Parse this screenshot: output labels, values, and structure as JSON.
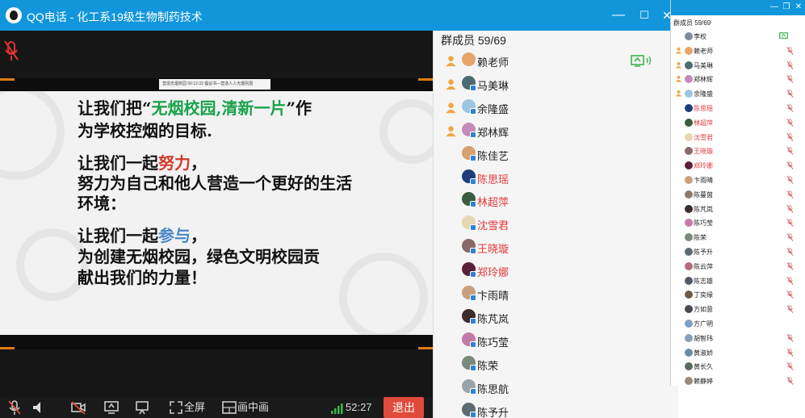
{
  "window": {
    "title": "QQ电话 - 化工系19级生物制药技术",
    "minimize": "—",
    "maximize": "☐",
    "close": "✕"
  },
  "slide": {
    "mini_caption": "营造无烟校园   00:12:32   倡议书—营造人人无烟氛围",
    "line1_a": "让我们把“",
    "line1_hl": "无烟校园,清新一片",
    "line1_b": "”作",
    "line2": "为学校控烟的目标.",
    "line3_a": "让我们一起",
    "line3_hl": "努力",
    "line3_b": "，",
    "line4": "努力为自己和他人营造一个更好的生活",
    "line5": "环境：",
    "line6_a": "让我们一起",
    "line6_hl": "参与",
    "line6_b": "，",
    "line7": "为创建无烟校园，绿色文明校园贡",
    "line8": "献出我们的力量！"
  },
  "toolbar": {
    "fullscreen_label": "全屏",
    "pip_label": "画中画",
    "timer": "52:27",
    "exit_label": "退出"
  },
  "members": {
    "header": "群成员 59/69",
    "rows": [
      {
        "name": "赖老师",
        "admin": true,
        "red": false,
        "avatar": "#e7a56b",
        "sharing": true
      },
      {
        "name": "马美琳",
        "admin": true,
        "red": false,
        "avatar": "#4d6b6e",
        "sharing": false
      },
      {
        "name": "余隆盛",
        "admin": true,
        "red": false,
        "avatar": "#9cc6e0",
        "sharing": false
      },
      {
        "name": "郑林辉",
        "admin": true,
        "red": false,
        "avatar": "#c58ab8",
        "sharing": false
      },
      {
        "name": "陈佳艺",
        "admin": false,
        "red": false,
        "avatar": "#d6a070",
        "sharing": false
      },
      {
        "name": "陈思瑶",
        "admin": false,
        "red": true,
        "avatar": "#1e3d7a",
        "sharing": false
      },
      {
        "name": "林超萍",
        "admin": false,
        "red": true,
        "avatar": "#3b5d3f",
        "sharing": false
      },
      {
        "name": "沈雪君",
        "admin": false,
        "red": true,
        "avatar": "#e6d6b2",
        "sharing": false
      },
      {
        "name": "王晓璇",
        "admin": false,
        "red": true,
        "avatar": "#8a6a66",
        "sharing": false
      },
      {
        "name": "郑玲娜",
        "admin": false,
        "red": true,
        "avatar": "#5a1f3a",
        "sharing": false
      },
      {
        "name": "卞雨晴",
        "admin": false,
        "red": false,
        "avatar": "#c9a07e",
        "sharing": false
      },
      {
        "name": "陈芃岚",
        "admin": false,
        "red": false,
        "avatar": "#3a2d2a",
        "sharing": false
      },
      {
        "name": "陈巧莹",
        "admin": false,
        "red": false,
        "avatar": "#c47aa5",
        "sharing": false
      },
      {
        "name": "陈荣",
        "admin": false,
        "red": false,
        "avatar": "#7b8a7a",
        "sharing": false
      },
      {
        "name": "陈思航",
        "admin": false,
        "red": false,
        "avatar": "#9aa4a8",
        "sharing": false
      },
      {
        "name": "陈予升",
        "admin": false,
        "red": false,
        "avatar": "#5d6b70",
        "sharing": false
      }
    ]
  },
  "small_window": {
    "minimize": "—",
    "restore": "❐",
    "close": "✕",
    "header": "群成员 59/69",
    "rows": [
      {
        "name": "李权",
        "admin": false,
        "red": false,
        "avatar": "#7e8b98",
        "share": true,
        "mute": false
      },
      {
        "name": "赖老师",
        "admin": true,
        "red": false,
        "avatar": "#e7a56b",
        "share": false,
        "mute": true
      },
      {
        "name": "马美琳",
        "admin": true,
        "red": false,
        "avatar": "#4d6b6e",
        "share": false,
        "mute": true
      },
      {
        "name": "郑林辉",
        "admin": true,
        "red": false,
        "avatar": "#c58ab8",
        "share": false,
        "mute": true
      },
      {
        "name": "余隆盛",
        "admin": true,
        "red": false,
        "avatar": "#9cc6e0",
        "share": false,
        "mute": true
      },
      {
        "name": "陈思瑶",
        "admin": false,
        "red": true,
        "avatar": "#1e3d7a",
        "share": false,
        "mute": true
      },
      {
        "name": "林超萍",
        "admin": false,
        "red": true,
        "avatar": "#3b5d3f",
        "share": false,
        "mute": true
      },
      {
        "name": "沈雪君",
        "admin": false,
        "red": true,
        "avatar": "#e6d6b2",
        "share": false,
        "mute": true
      },
      {
        "name": "王晓璇",
        "admin": false,
        "red": true,
        "avatar": "#8a6a66",
        "share": false,
        "mute": true
      },
      {
        "name": "郑玲娜",
        "admin": false,
        "red": true,
        "avatar": "#5a1f3a",
        "share": false,
        "mute": true
      },
      {
        "name": "卞雨晴",
        "admin": false,
        "red": false,
        "avatar": "#c9a07e",
        "share": false,
        "mute": true
      },
      {
        "name": "陈蔓茵",
        "admin": false,
        "red": false,
        "avatar": "#8c7c70",
        "share": false,
        "mute": true
      },
      {
        "name": "陈芃岚",
        "admin": false,
        "red": false,
        "avatar": "#3a2d2a",
        "share": false,
        "mute": true
      },
      {
        "name": "陈巧莹",
        "admin": false,
        "red": false,
        "avatar": "#c47aa5",
        "share": false,
        "mute": true
      },
      {
        "name": "陈荣",
        "admin": false,
        "red": false,
        "avatar": "#7b8a7a",
        "share": false,
        "mute": true
      },
      {
        "name": "陈予升",
        "admin": false,
        "red": false,
        "avatar": "#5d6b70",
        "share": false,
        "mute": true
      },
      {
        "name": "陈云萍",
        "admin": false,
        "red": false,
        "avatar": "#b66b7a",
        "share": false,
        "mute": true
      },
      {
        "name": "陈志雄",
        "admin": false,
        "red": false,
        "avatar": "#505a66",
        "share": false,
        "mute": true
      },
      {
        "name": "丁奕缘",
        "admin": false,
        "red": false,
        "avatar": "#6b5a4a",
        "share": false,
        "mute": true
      },
      {
        "name": "方如意",
        "admin": false,
        "red": false,
        "avatar": "#4a4a52",
        "share": false,
        "mute": true
      },
      {
        "name": "方广明",
        "admin": false,
        "red": false,
        "avatar": "#7ea0c4",
        "share": false,
        "mute": false
      },
      {
        "name": "胡智玮",
        "admin": false,
        "red": false,
        "avatar": "#8aa0b8",
        "share": false,
        "mute": true
      },
      {
        "name": "黄淑娇",
        "admin": false,
        "red": false,
        "avatar": "#6a8ea0",
        "share": false,
        "mute": true
      },
      {
        "name": "黄长久",
        "admin": false,
        "red": false,
        "avatar": "#5a6a5a",
        "share": false,
        "mute": true
      },
      {
        "name": "赖静婷",
        "admin": false,
        "red": false,
        "avatar": "#9a8a7a",
        "share": false,
        "mute": true
      }
    ]
  },
  "colors": {
    "title_blue": "#1296db",
    "exit_red": "#e04a3a",
    "member_red": "#e13a3a",
    "highlight_green": "#1aa24a",
    "signal_green": "#3bb54a"
  }
}
